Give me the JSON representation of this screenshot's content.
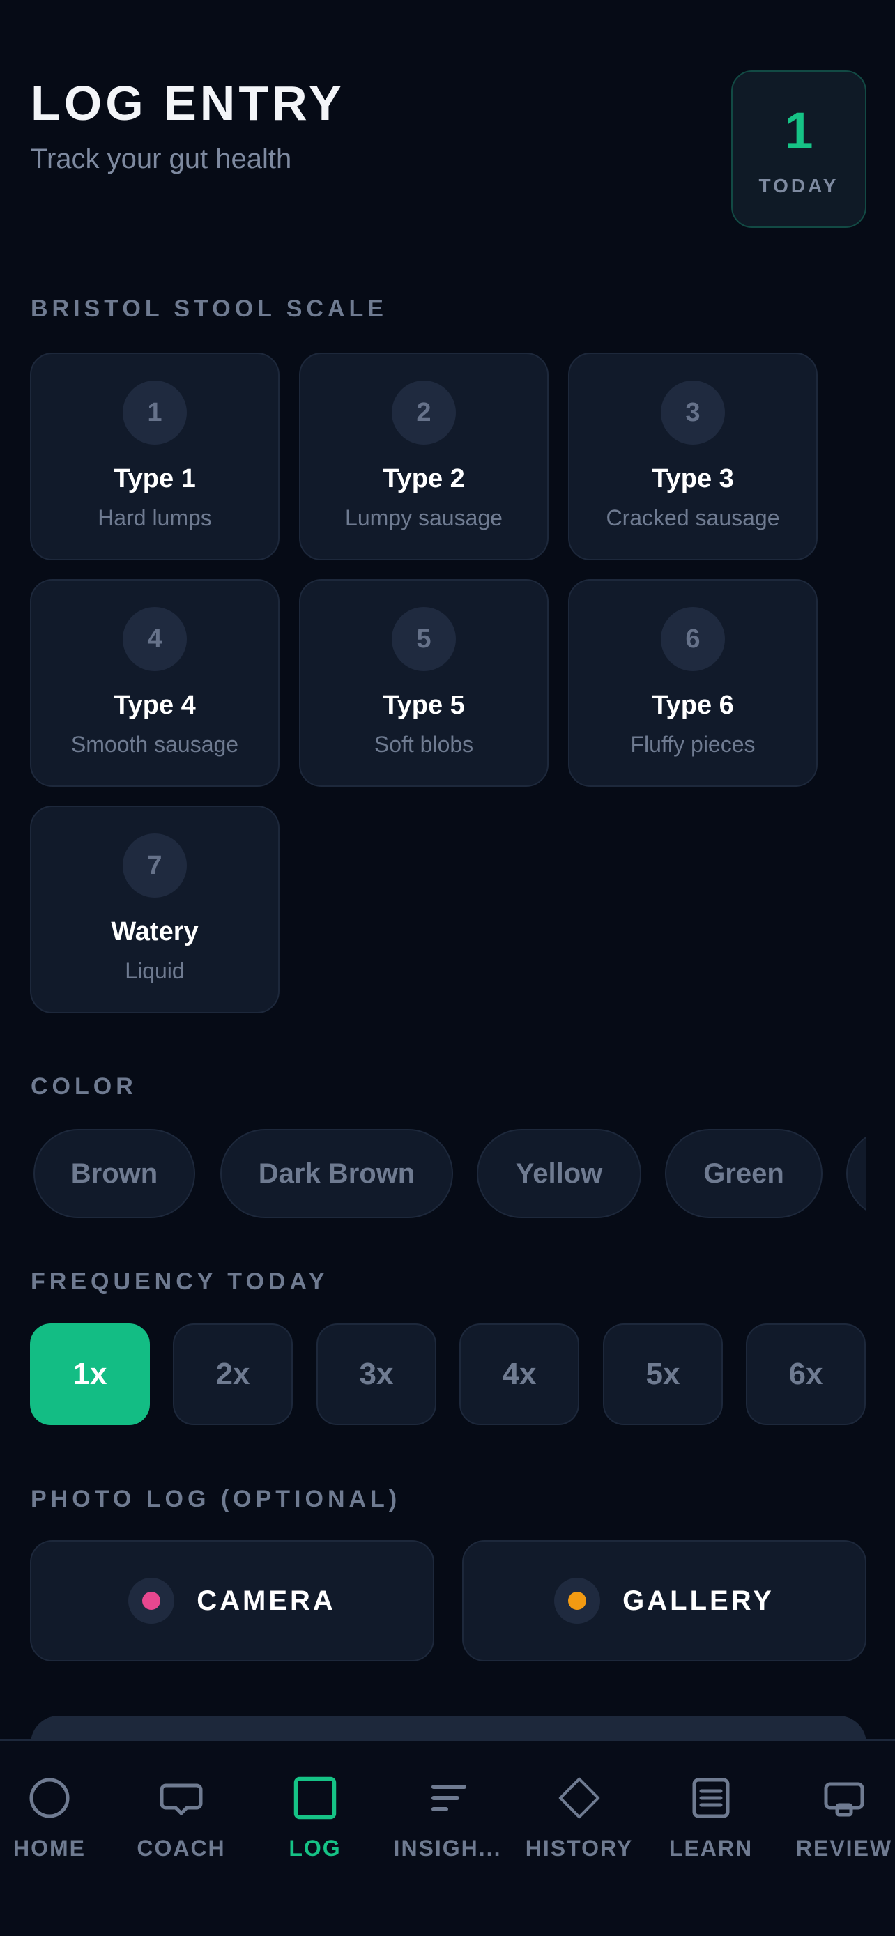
{
  "header": {
    "title": "LOG ENTRY",
    "subtitle": "Track your gut health",
    "today_count": "1",
    "today_label": "TODAY"
  },
  "bristol": {
    "label": "BRISTOL STOOL SCALE",
    "types": [
      {
        "num": "1",
        "name": "Type 1",
        "desc": "Hard lumps"
      },
      {
        "num": "2",
        "name": "Type 2",
        "desc": "Lumpy sausage"
      },
      {
        "num": "3",
        "name": "Type 3",
        "desc": "Cracked sausage"
      },
      {
        "num": "4",
        "name": "Type 4",
        "desc": "Smooth sausage"
      },
      {
        "num": "5",
        "name": "Type 5",
        "desc": "Soft blobs"
      },
      {
        "num": "6",
        "name": "Type 6",
        "desc": "Fluffy pieces"
      },
      {
        "num": "7",
        "name": "Watery",
        "desc": "Liquid"
      }
    ]
  },
  "color": {
    "label": "COLOR",
    "options": [
      "Brown",
      "Dark Brown",
      "Yellow",
      "Green",
      ""
    ]
  },
  "frequency": {
    "label": "FREQUENCY TODAY",
    "options": [
      "1x",
      "2x",
      "3x",
      "4x",
      "5x",
      "6x"
    ],
    "selected": "1x"
  },
  "photo": {
    "label": "PHOTO LOG (OPTIONAL)",
    "camera": "CAMERA",
    "gallery": "GALLERY",
    "camera_color": "#e8478f",
    "gallery_color": "#f29a12"
  },
  "nav": {
    "items": [
      {
        "label": "HOME",
        "icon": "home-circle-icon"
      },
      {
        "label": "COACH",
        "icon": "chat-bubble-icon"
      },
      {
        "label": "LOG",
        "icon": "log-square-icon"
      },
      {
        "label": "INSIGH...",
        "icon": "insights-bars-icon"
      },
      {
        "label": "HISTORY",
        "icon": "diamond-icon"
      },
      {
        "label": "LEARN",
        "icon": "document-icon"
      },
      {
        "label": "REVIEW",
        "icon": "review-screen-icon"
      }
    ],
    "active": "LOG"
  },
  "colors": {
    "accent": "#16c386",
    "background": "#060b16",
    "card": "#111a2a"
  }
}
